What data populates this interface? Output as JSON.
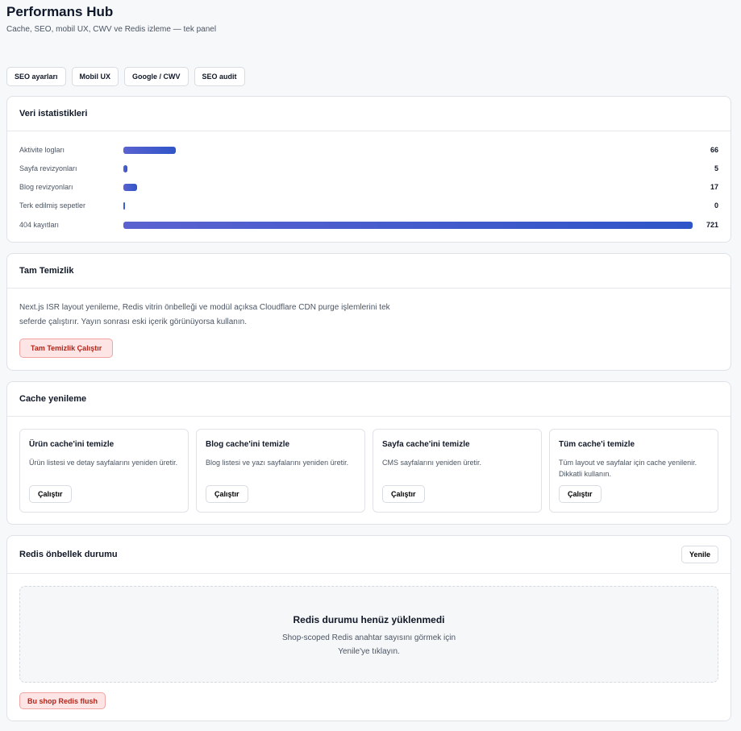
{
  "header": {
    "title": "Performans Hub",
    "subtitle": "Cache, SEO, mobil UX, CWV ve Redis izleme — tek panel"
  },
  "tabs": [
    {
      "label": "SEO ayarları"
    },
    {
      "label": "Mobil UX"
    },
    {
      "label": "Google / CWV"
    },
    {
      "label": "SEO audit"
    }
  ],
  "stats": {
    "title": "Veri istatistikleri",
    "rows": [
      {
        "label": "Aktivite logları",
        "value": 66,
        "display": "66"
      },
      {
        "label": "Sayfa revizyonları",
        "value": 5,
        "display": "5"
      },
      {
        "label": "Blog revizyonları",
        "value": 17,
        "display": "17"
      },
      {
        "label": "Terk edilmiş sepetler",
        "value": 0,
        "display": "0"
      },
      {
        "label": "404 kayıtları",
        "value": 721,
        "display": "721"
      }
    ]
  },
  "full_clean": {
    "title": "Tam Temizlik",
    "description": "Next.js ISR layout yenileme, Redis vitrin önbelleği ve modül açıksa Cloudflare CDN purge işlemlerini tek seferde çalıştırır. Yayın sonrası eski içerik görünüyorsa kullanın.",
    "button": "Tam Temizlik Çalıştır"
  },
  "cache": {
    "title": "Cache yenileme",
    "items": [
      {
        "title": "Ürün cache'ini temizle",
        "description": "Ürün listesi ve detay sayfalarını yeniden üretir.",
        "button": "Çalıştır"
      },
      {
        "title": "Blog cache'ini temizle",
        "description": "Blog listesi ve yazı sayfalarını yeniden üretir.",
        "button": "Çalıştır"
      },
      {
        "title": "Sayfa cache'ini temizle",
        "description": "CMS sayfalarını yeniden üretir.",
        "button": "Çalıştır"
      },
      {
        "title": "Tüm cache'i temizle",
        "description": "Tüm layout ve sayfalar için cache yenilenir. Dikkatli kullanın.",
        "button": "Çalıştır"
      }
    ]
  },
  "redis": {
    "title": "Redis önbellek durumu",
    "refresh": "Yenile",
    "empty_title": "Redis durumu henüz yüklenmedi",
    "empty_text": "Shop-scoped Redis anahtar sayısını görmek için Yenile'ye tıklayın.",
    "flush_button": "Bu shop Redis flush"
  },
  "colors": {
    "bar": "#3456c8",
    "danger": "#b42318"
  }
}
